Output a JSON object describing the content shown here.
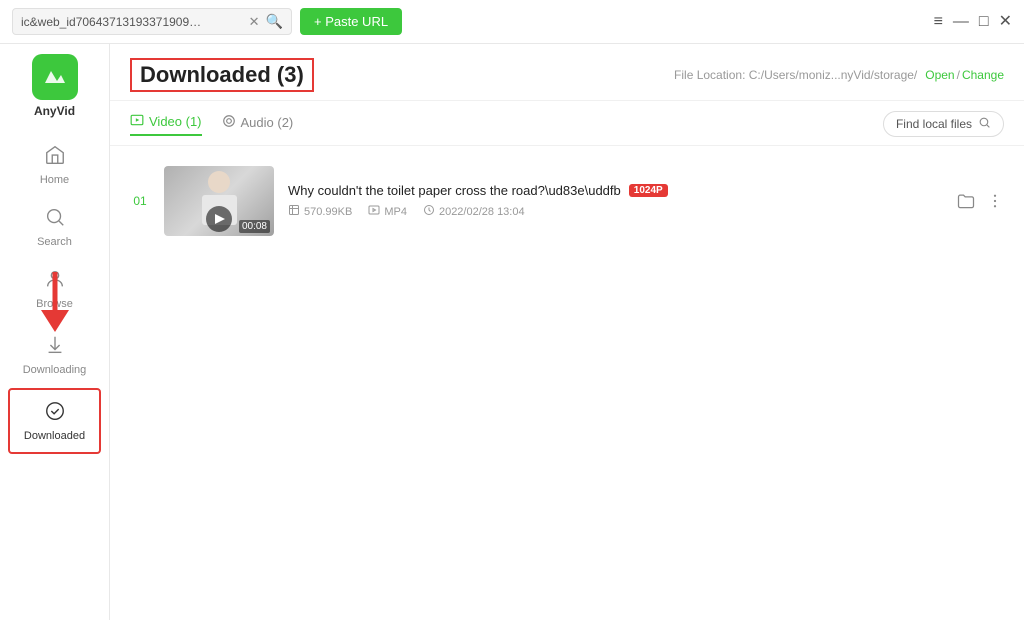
{
  "titlebar": {
    "url_text": "ic&web_id70643713193371909…",
    "paste_url_label": "+ Paste URL",
    "window_controls": [
      "≡",
      "—",
      "□",
      "✕"
    ]
  },
  "logo": {
    "name": "AnyVid"
  },
  "sidebar": {
    "items": [
      {
        "id": "home",
        "label": "Home",
        "icon": "🏠"
      },
      {
        "id": "search",
        "label": "Search",
        "icon": "🔍"
      },
      {
        "id": "browse",
        "label": "Browse",
        "icon": "👤"
      },
      {
        "id": "downloading",
        "label": "Downloading",
        "icon": "⬇"
      },
      {
        "id": "downloaded",
        "label": "Downloaded",
        "icon": "✓",
        "active": true
      }
    ]
  },
  "content": {
    "page_title": "Downloaded (3)",
    "file_location_label": "File Location: C:/Users/moniz...nyVid/storage/",
    "open_label": "Open",
    "change_label": "Change",
    "tabs": [
      {
        "id": "video",
        "label": "Video (1)",
        "active": true
      },
      {
        "id": "audio",
        "label": "Audio (2)",
        "active": false
      }
    ],
    "find_local_label": "Find local files",
    "videos": [
      {
        "index": "01",
        "title": "Why couldn't the toilet paper cross the road?\\ud83e\\uddfb",
        "quality": "1024P",
        "size": "570.99KB",
        "format": "MP4",
        "date": "2022/02/28 13:04",
        "duration": "00:08"
      }
    ]
  }
}
